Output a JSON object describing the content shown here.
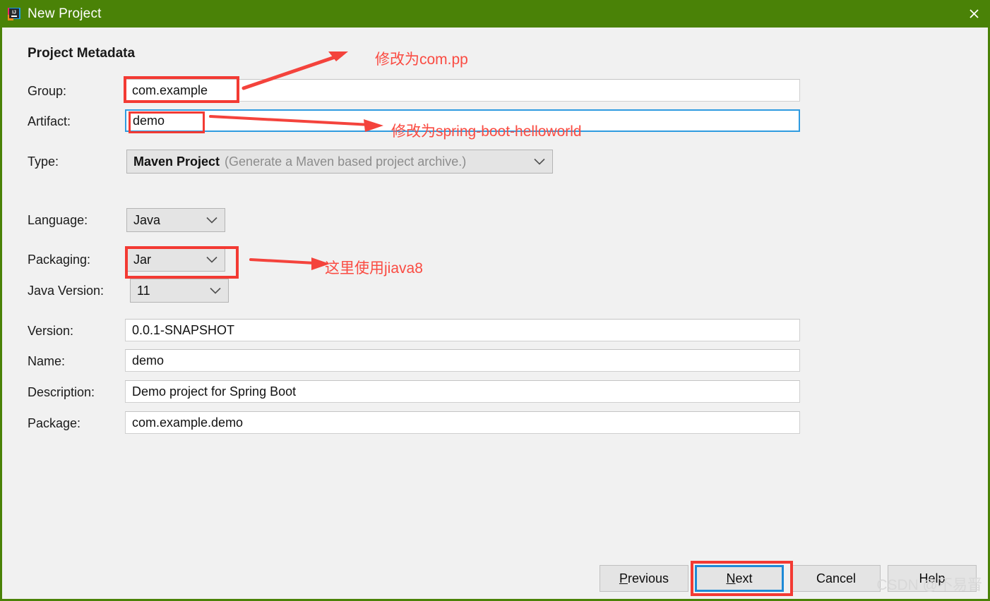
{
  "window": {
    "title": "New Project",
    "app_icon": "intellij-idea-icon",
    "close_icon": "close-icon",
    "titlebar_color": "#4a8207",
    "background_color": "#f1f1f1"
  },
  "form": {
    "section_title": "Project Metadata",
    "rows": [
      {
        "label": "Group:",
        "value": "com.example",
        "kind": "text"
      },
      {
        "label": "Artifact:",
        "value": "demo",
        "kind": "text-focused"
      },
      {
        "label": "Type:",
        "value": "Maven Project",
        "hint": "(Generate a Maven based project archive.)",
        "kind": "combo"
      },
      {
        "label": "Language:",
        "value": "Java",
        "kind": "combo"
      },
      {
        "label": "Packaging:",
        "value": "Jar",
        "kind": "combo"
      },
      {
        "label": "Java Version:",
        "value": "11",
        "kind": "combo"
      },
      {
        "label": "Version:",
        "value": "0.0.1-SNAPSHOT",
        "kind": "text"
      },
      {
        "label": "Name:",
        "value": "demo",
        "kind": "text"
      },
      {
        "label": "Description:",
        "value": "Demo project for Spring Boot",
        "kind": "text"
      },
      {
        "label": "Package:",
        "value": "com.example.demo",
        "kind": "text"
      }
    ]
  },
  "buttons": {
    "previous": {
      "pre": "",
      "mnemonic": "P",
      "post": "revious"
    },
    "next": {
      "pre": "",
      "mnemonic": "N",
      "post": "ext"
    },
    "cancel": {
      "pre": "",
      "mnemonic": "",
      "post": "Cancel"
    },
    "help": {
      "pre": "",
      "mnemonic": "",
      "post": "Help"
    }
  },
  "annotations": {
    "color": "#fa4b42",
    "notes": [
      {
        "text": "修改为com.pp",
        "target": "group-field"
      },
      {
        "text": "修改为spring-boot-helloworld",
        "target": "artifact-field"
      },
      {
        "text": "这里使用jiava8",
        "target": "java-version-combo"
      }
    ],
    "highlight_boxes": [
      "group-field",
      "artifact-value",
      "java-version-combo",
      "next-button"
    ]
  },
  "watermark": {
    "text": "CSDN @不易晋"
  }
}
